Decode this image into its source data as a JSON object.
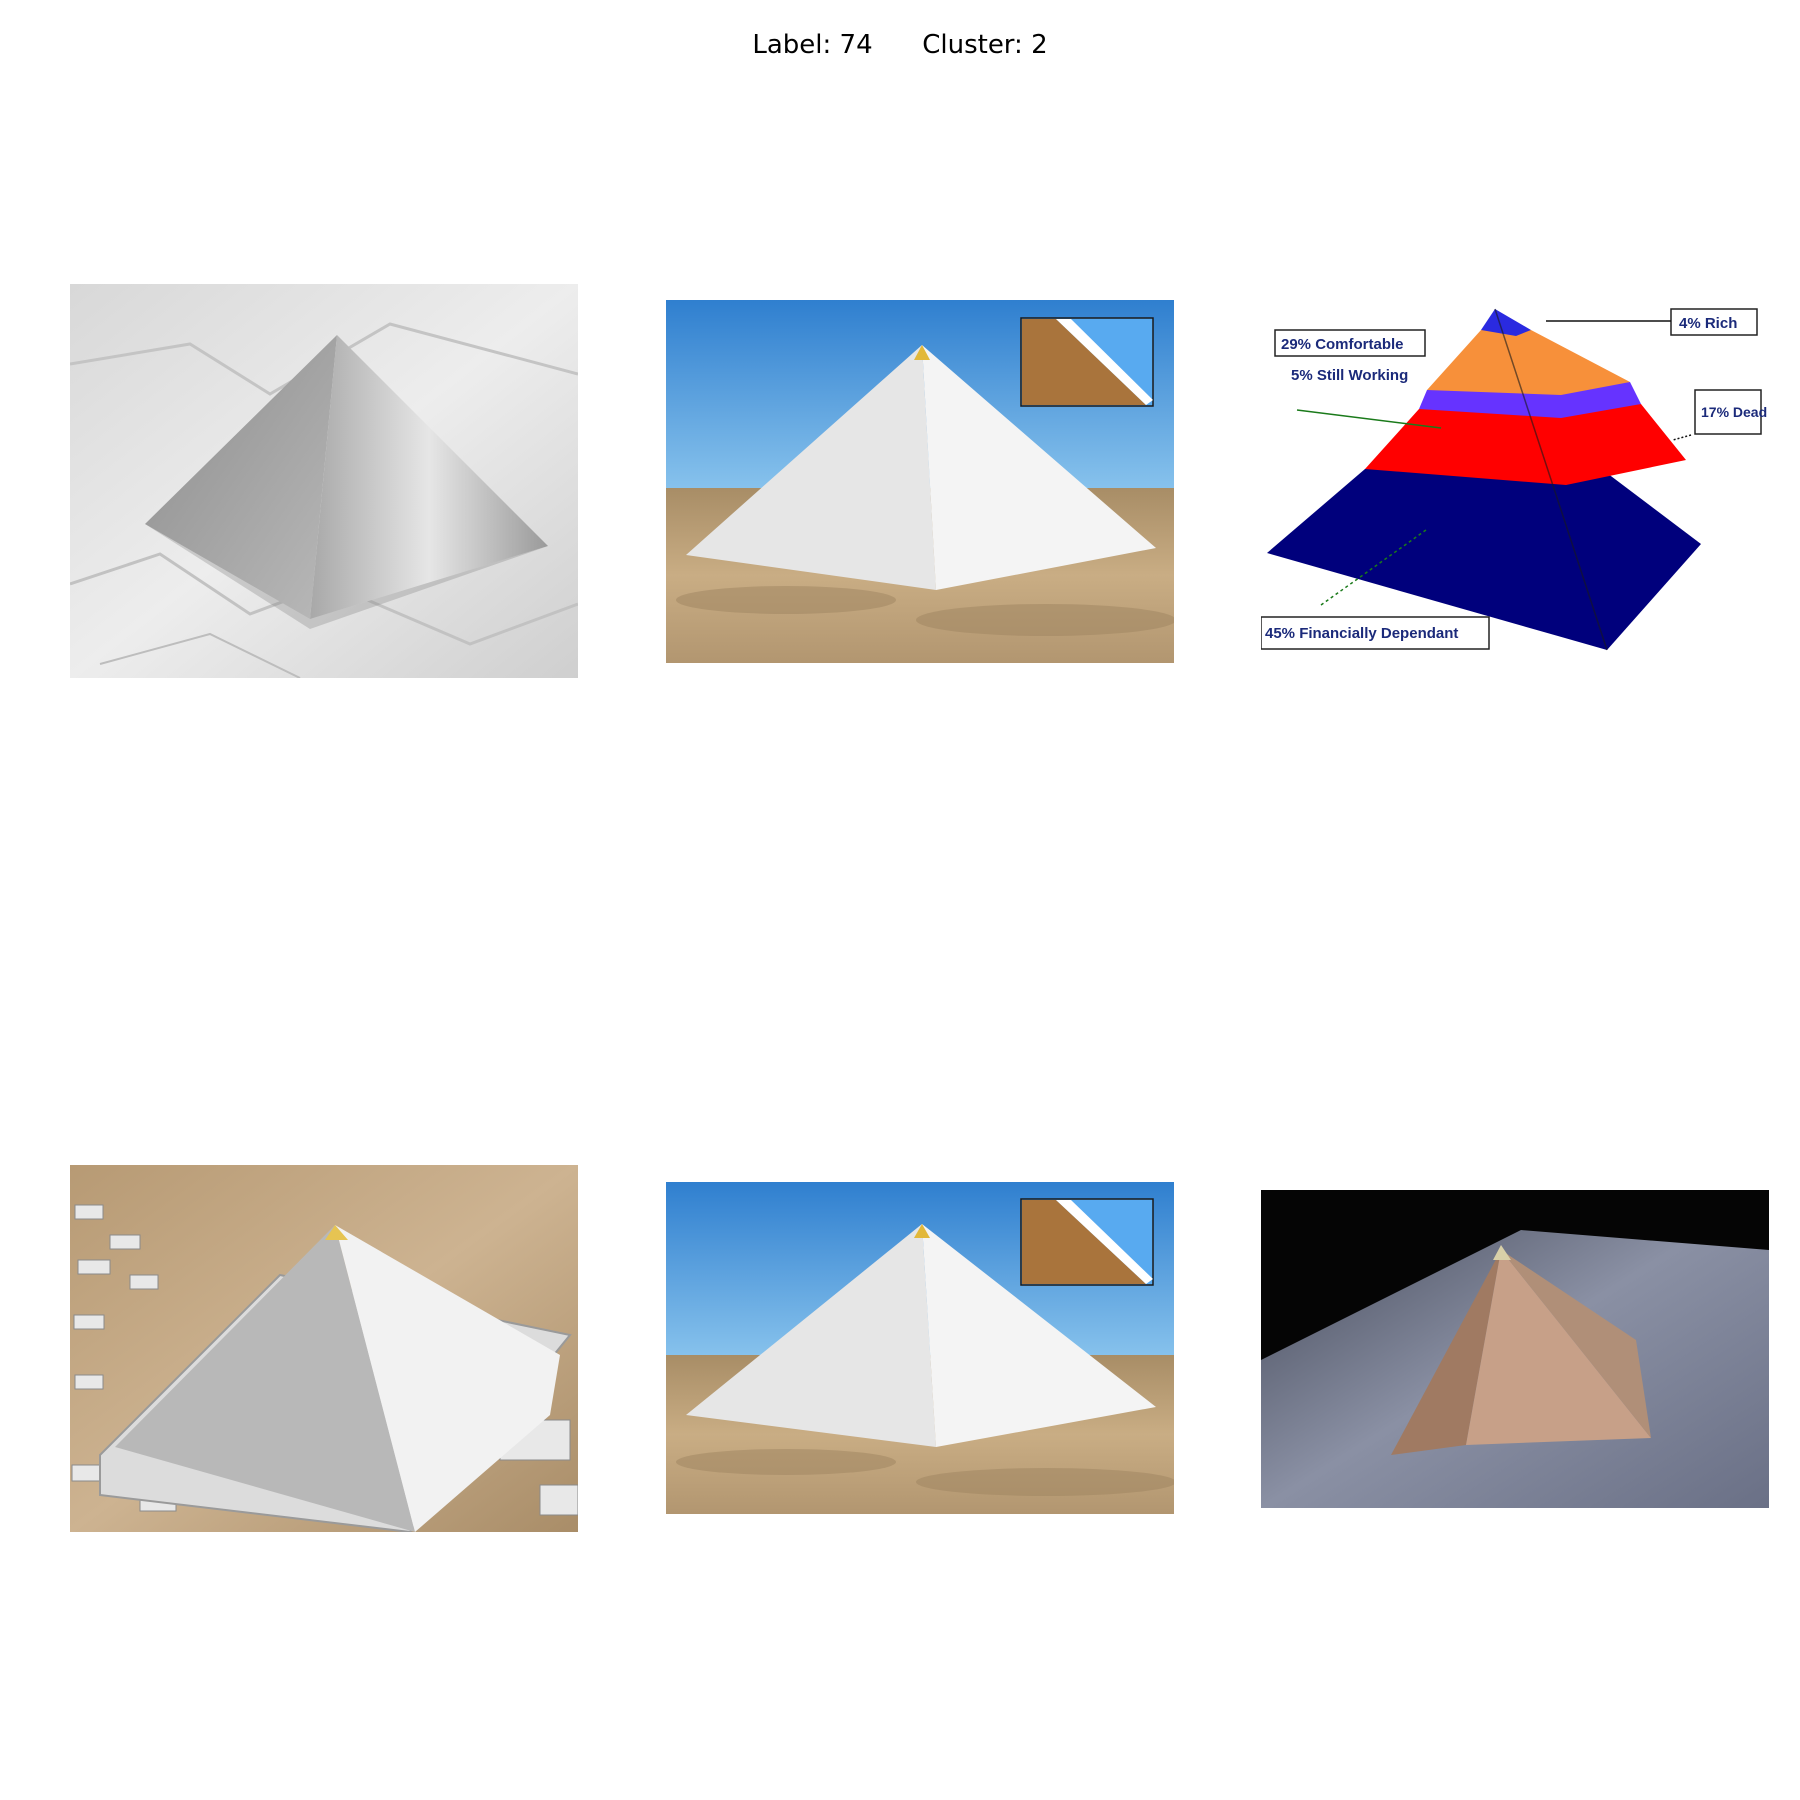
{
  "header": {
    "label_text": "Label: 74",
    "cluster_text": "Cluster: 2"
  },
  "grid": {
    "rows": 2,
    "columns": 3,
    "tiles": [
      {
        "subject": "metal-pyramid-on-paper"
      },
      {
        "subject": "white-pyramid-desert-with-inset"
      },
      {
        "subject": "financial-pyramid-diagram"
      },
      {
        "subject": "aerial-pyramid-complex"
      },
      {
        "subject": "white-pyramid-desert-with-inset"
      },
      {
        "subject": "stone-pyramid-model-on-carpet"
      }
    ]
  },
  "diagram_labels": {
    "rich": "4% Rich",
    "comfortable": "29% Comfortable",
    "still_working": "5% Still Working",
    "dead": "17% Dead",
    "dependant": "45% Financially Dependant"
  },
  "colors": {
    "sky": "#3e8fd6",
    "sand": "#b89a72",
    "pyramid_white": "#ececec",
    "diagram_navy": "#00007c",
    "diagram_red": "#ff0000",
    "diagram_orange": "#f7903a",
    "diagram_purple": "#6633ff"
  }
}
